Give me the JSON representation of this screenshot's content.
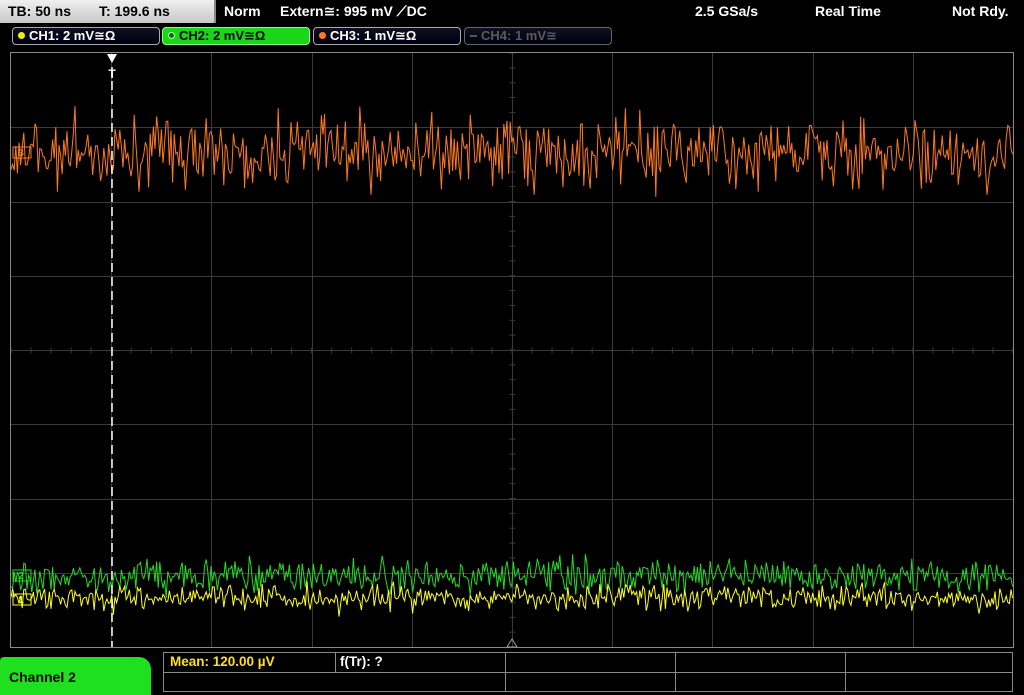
{
  "status": {
    "timebase": "TB: 50 ns",
    "trigger_pos": "T: 199.6 ns",
    "trigger_mode": "Norm",
    "trigger_source": "Extern≅: 995 mV ⟋DC",
    "sample_rate": "2.5 GSa/s",
    "acq_mode": "Real Time",
    "state": "Not Rdy."
  },
  "channels": [
    {
      "label": "CH1: 2 mV≅Ω",
      "color": "#f0f010",
      "state": "on"
    },
    {
      "label": "CH2: 2 mV≅Ω",
      "color": "#20e020",
      "state": "active"
    },
    {
      "label": "CH3: 1 mV≅Ω",
      "color": "#ff7a22",
      "state": "on"
    },
    {
      "label": "CH4: 1 mV≅",
      "color": "#606060",
      "state": "off"
    }
  ],
  "waveform_markers": {
    "trigger_marker": "T",
    "ch1_marker": "1",
    "ch2_marker": "2",
    "ch3_marker": "3"
  },
  "active_channel_tab": "Channel 2",
  "measurements": {
    "mean": "Mean: 120.00 µV",
    "ftr": "f(Tr): ?"
  },
  "colors": {
    "grid": "#3a3a3a",
    "ch1": "#ffff20",
    "ch2": "#22dd22",
    "ch3": "#ff7a1e"
  }
}
